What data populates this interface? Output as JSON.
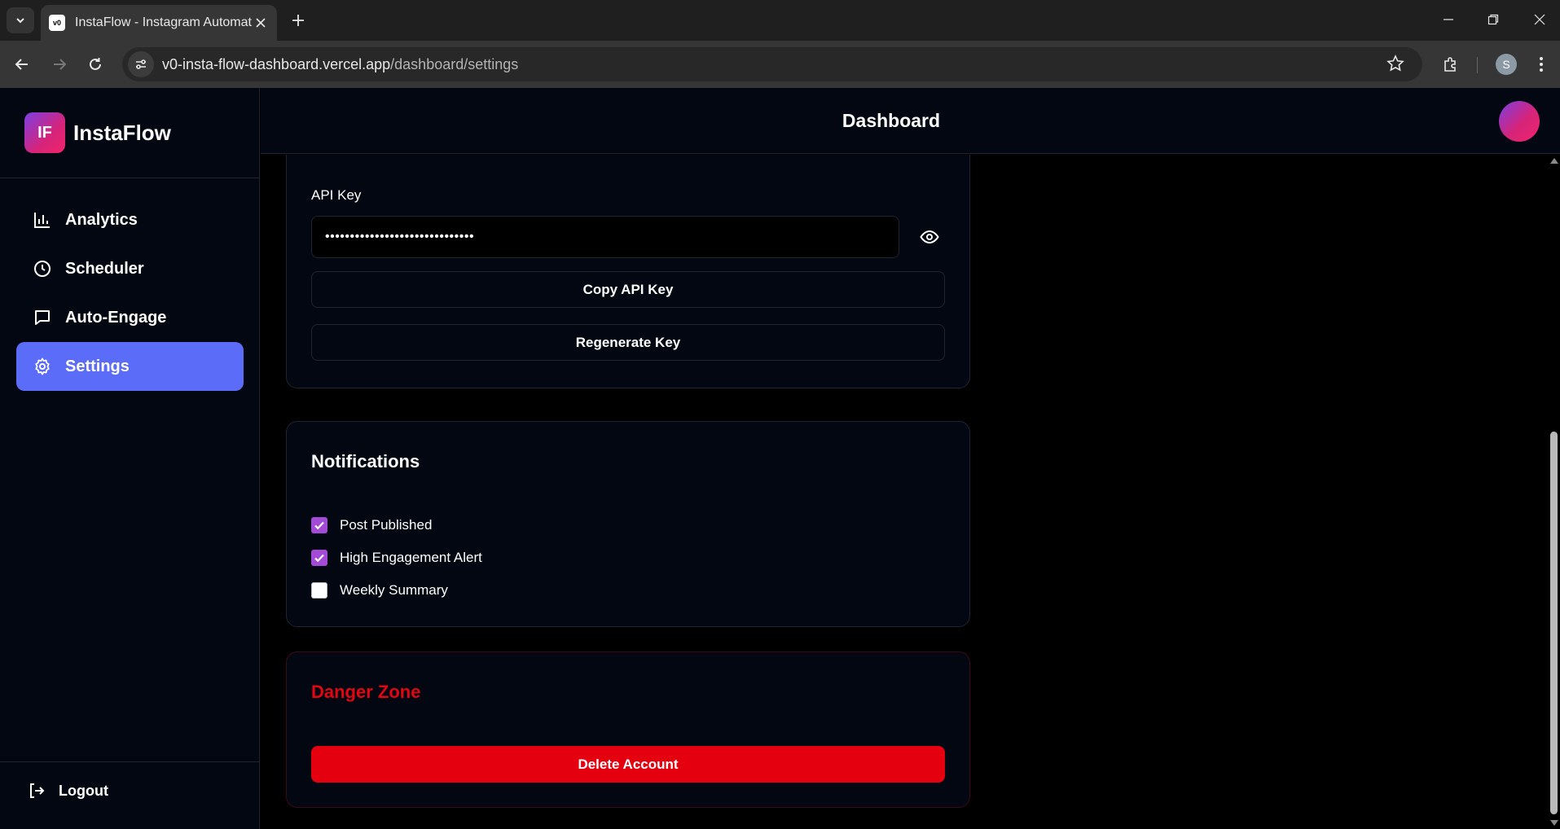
{
  "browser": {
    "tab_title": "InstaFlow - Instagram Automati",
    "favicon_text": "v0",
    "url_host": "v0-insta-flow-dashboard.vercel.app",
    "url_path": "/dashboard/settings",
    "profile_initial": "S"
  },
  "brand": {
    "logo_text": "IF",
    "name": "InstaFlow"
  },
  "sidebar": {
    "items": [
      {
        "label": "Analytics",
        "icon": "bar-chart-icon",
        "active": false
      },
      {
        "label": "Scheduler",
        "icon": "clock-icon",
        "active": false
      },
      {
        "label": "Auto-Engage",
        "icon": "message-icon",
        "active": false
      },
      {
        "label": "Settings",
        "icon": "gear-icon",
        "active": true
      }
    ],
    "logout_label": "Logout"
  },
  "header": {
    "title": "Dashboard"
  },
  "api_card": {
    "label": "API Key",
    "masked_value": "••••••••••••••••••••••••••••••",
    "copy_label": "Copy API Key",
    "regenerate_label": "Regenerate Key"
  },
  "notifications": {
    "title": "Notifications",
    "options": [
      {
        "label": "Post Published",
        "checked": true
      },
      {
        "label": "High Engagement Alert",
        "checked": true
      },
      {
        "label": "Weekly Summary",
        "checked": false
      }
    ]
  },
  "danger": {
    "title": "Danger Zone",
    "delete_label": "Delete Account"
  },
  "colors": {
    "accent": "#5b6cf9",
    "danger": "#e4000f",
    "checkbox": "#a34bd6",
    "background": "#030712"
  }
}
